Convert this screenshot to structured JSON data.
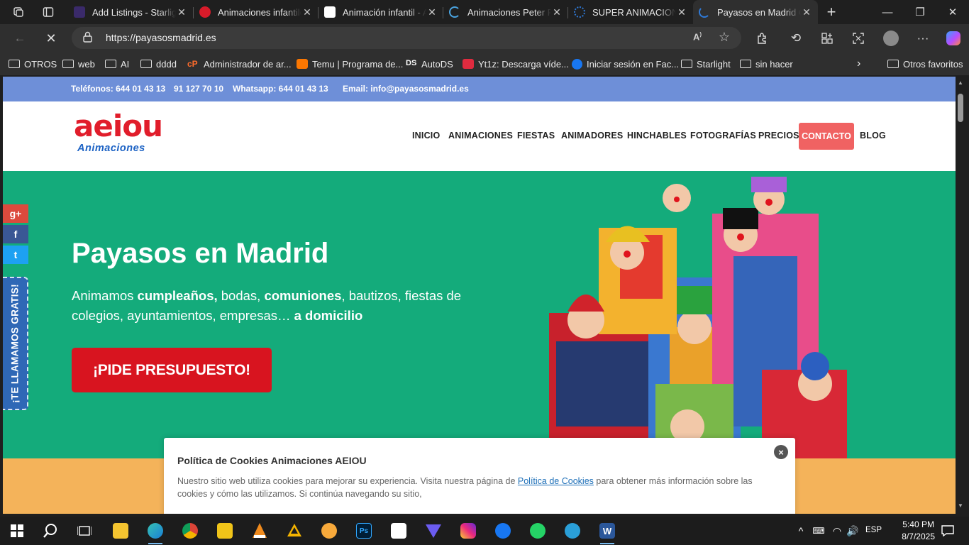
{
  "browser": {
    "tabs": [
      {
        "title": "Add Listings - Starlight",
        "favicon_color": "#3a2a6a"
      },
      {
        "title": "Animaciones infantiles",
        "favicon_color": "#d81b2a"
      },
      {
        "title": "Animación infantil - A",
        "favicon_color": "#ffffff"
      },
      {
        "title": "Animaciones Peter Pan",
        "favicon_color": "#4aa3e0"
      },
      {
        "title": "SUPER ANIMACIONES",
        "favicon_color": "#2f7ad8"
      },
      {
        "title": "Payasos en Madrid Cu",
        "favicon_color": "#2f7ad8"
      }
    ],
    "url": "https://payasosmadrid.es",
    "bookmarks": [
      {
        "label": "OTROS",
        "kind": "folder"
      },
      {
        "label": "web",
        "kind": "folder"
      },
      {
        "label": "AI",
        "kind": "folder"
      },
      {
        "label": "dddd",
        "kind": "folder"
      },
      {
        "label": "Administrador de ar...",
        "kind": "cpanel"
      },
      {
        "label": "Temu | Programa de...",
        "kind": "temu"
      },
      {
        "label": "AutoDS",
        "kind": "autods"
      },
      {
        "label": "Yt1z: Descarga víde...",
        "kind": "yt1z"
      },
      {
        "label": "Iniciar sesión en Fac...",
        "kind": "facebook"
      },
      {
        "label": "Starlight",
        "kind": "folder"
      },
      {
        "label": "sin hacer",
        "kind": "folder"
      }
    ],
    "other_favorites": "Otros favoritos"
  },
  "site": {
    "topbar": {
      "phones": "Teléfonos: 644 01 43 13",
      "phone2": "91 127 70 10",
      "whatsapp": "Whatsapp: 644 01 43 13",
      "email": "Email: info@payasosmadrid.es"
    },
    "logo": {
      "top": "aeiou",
      "bottom": "Animaciones"
    },
    "menu": [
      "INICIO",
      "ANIMACIONES",
      "FIESTAS",
      "ANIMADORES",
      "HINCHABLES",
      "FOTOGRAFÍAS",
      "PRECIOS",
      "CONTACTO",
      "BLOG"
    ],
    "hero": {
      "title": "Payasos en Madrid",
      "sub": {
        "t1": "Animamos ",
        "b1": "cumpleaños,",
        "t2": " bodas, ",
        "b2": "comuniones",
        "t3": ", bautizos, fiestas de colegios, ayuntamientos, empresas… ",
        "b3": "a domicilio"
      },
      "cta": "¡PIDE PRESUPUESTO!"
    },
    "side_tab": "¡TE LLAMAMOS GRATIS!",
    "social": {
      "google": "g+",
      "facebook": "f",
      "twitter": "t"
    },
    "cookie": {
      "title": "Política de Cookies Animaciones AEIOU",
      "text_before": "Nuestro sitio web utiliza cookies para mejorar su experiencia. Visita nuestra página de ",
      "link": "Política de Cookies",
      "text_after": " para obtener más información sobre las cookies y cómo las utilizamos. Si continúa navegando su sitio,"
    }
  },
  "taskbar": {
    "time": "5:40 PM",
    "date": "8/7/2025",
    "lang": "ESP"
  },
  "colors": {
    "topbar": "#6e8fd8",
    "hero": "#14ab7b",
    "cta": "#d8141f",
    "contacto": "#f06262",
    "orange_band": "#f4b35a",
    "side_tab": "#2f68b6"
  }
}
